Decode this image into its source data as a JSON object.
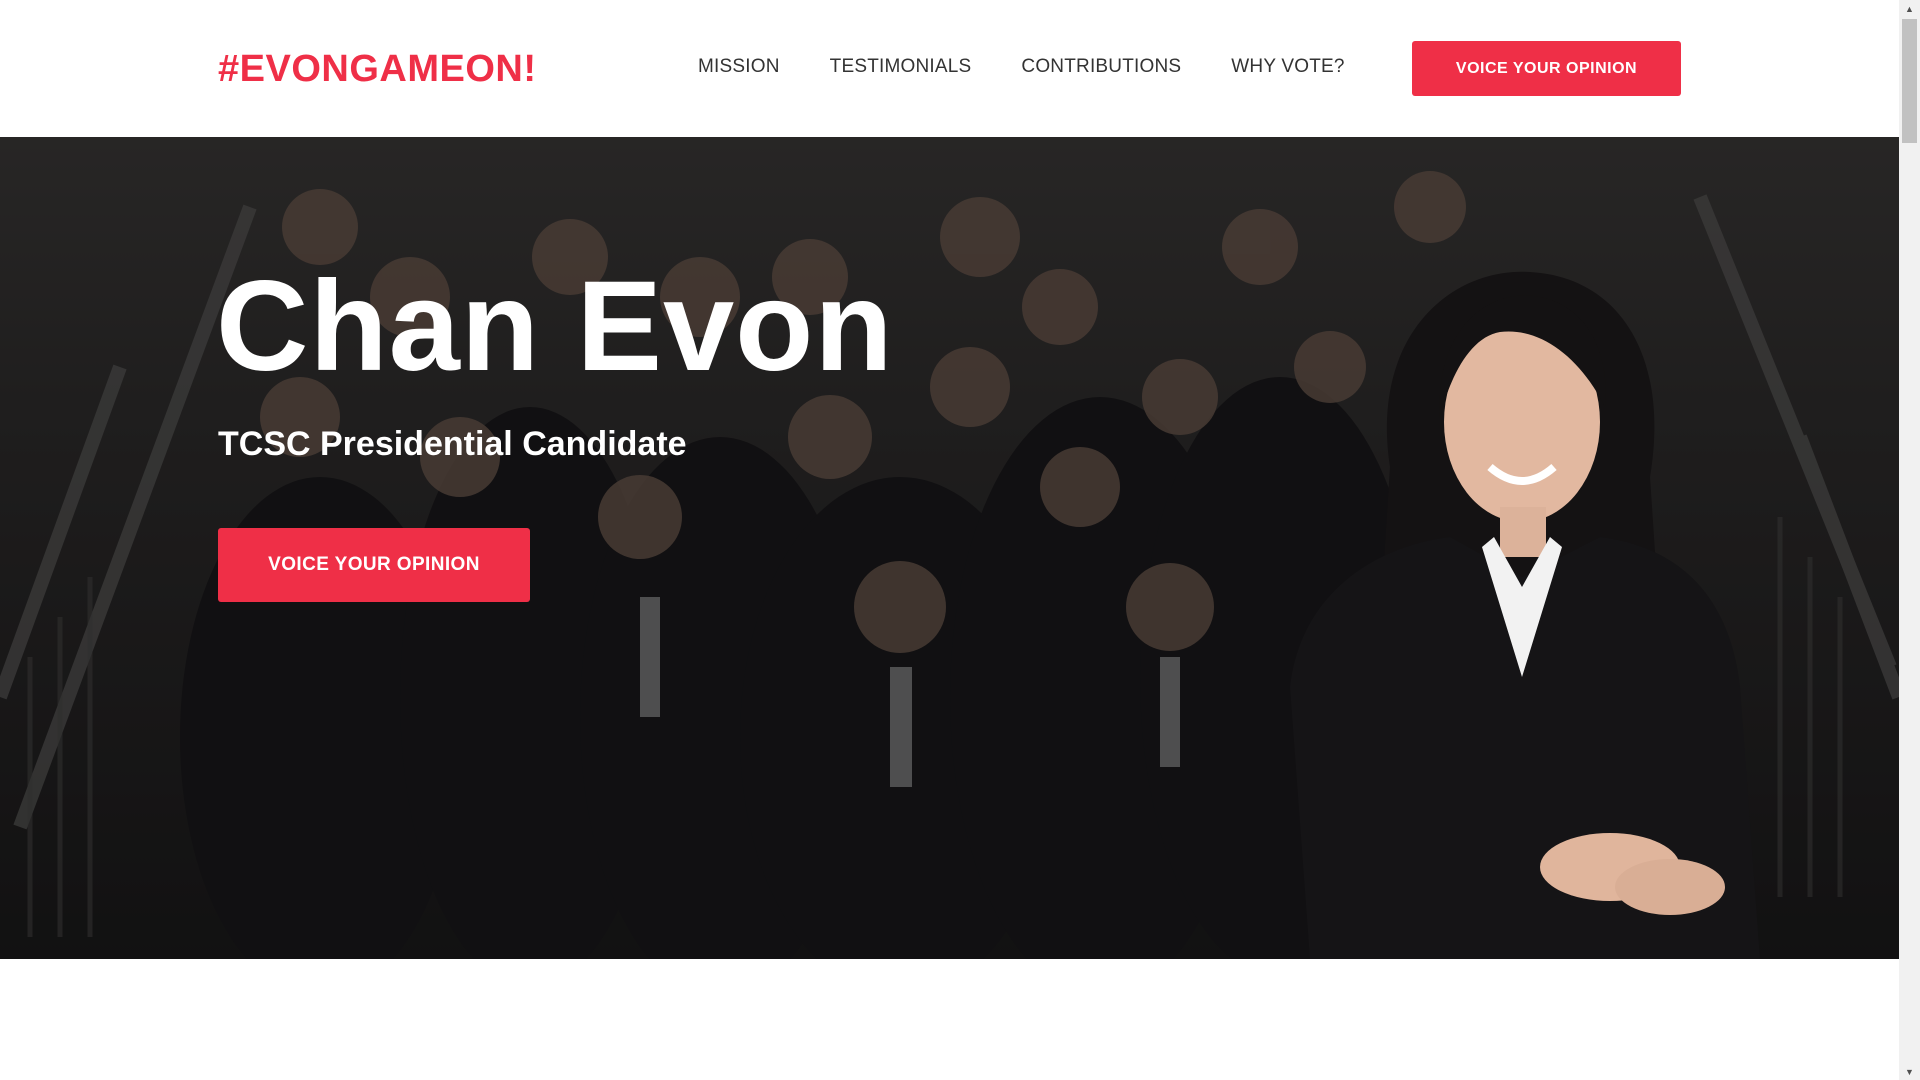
{
  "header": {
    "logo": "#EVONGAMEON!",
    "nav": [
      {
        "label": "MISSION"
      },
      {
        "label": "TESTIMONIALS"
      },
      {
        "label": "CONTRIBUTIONS"
      },
      {
        "label": "WHY VOTE?"
      }
    ],
    "cta_label": "VOICE YOUR OPINION"
  },
  "hero": {
    "title": "Chan Evon",
    "subtitle": "TCSC Presidential Candidate",
    "cta_label": "VOICE YOUR OPINION"
  },
  "colors": {
    "accent": "#ef2f47",
    "nav_text": "#333333",
    "hero_text": "#ffffff"
  },
  "icons": {
    "scroll_up": "scroll-up-arrow-icon",
    "scroll_down": "scroll-down-arrow-icon"
  }
}
